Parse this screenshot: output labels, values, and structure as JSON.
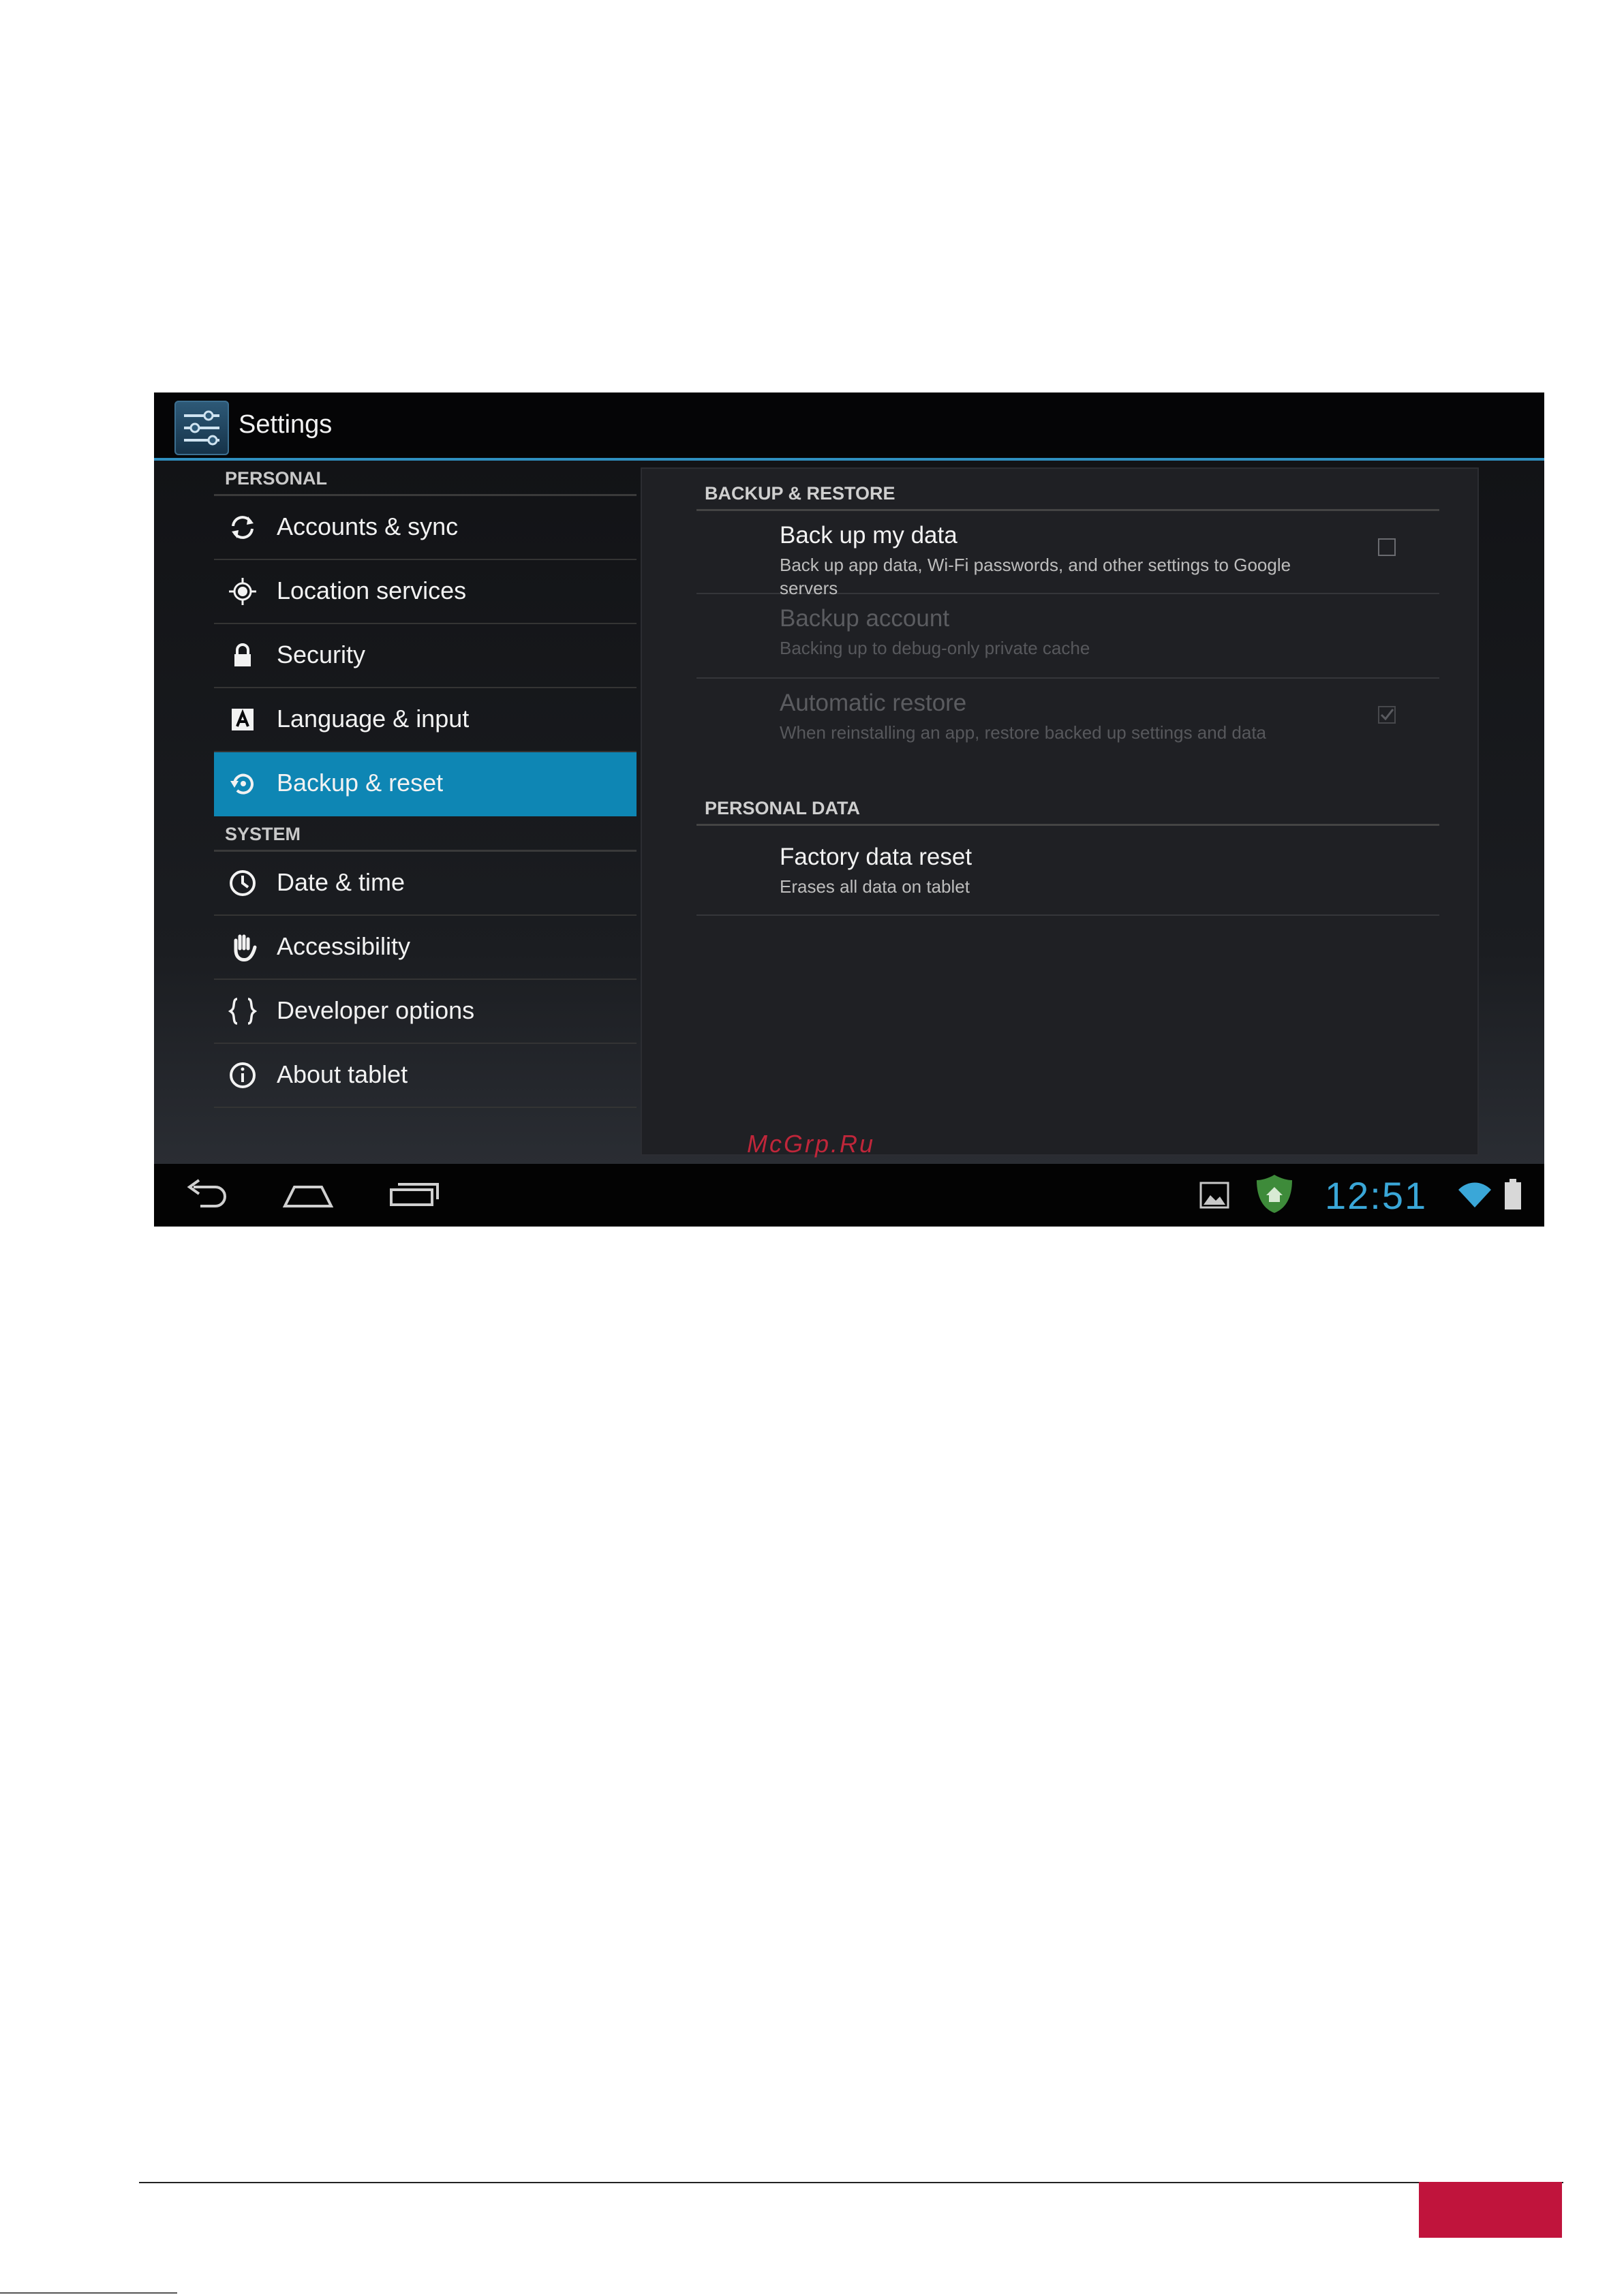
{
  "actionbar": {
    "title": "Settings"
  },
  "sidebar": {
    "sections": [
      {
        "header": "PERSONAL",
        "items": [
          {
            "label": "Accounts & sync",
            "icon": "sync-icon"
          },
          {
            "label": "Location services",
            "icon": "location-icon"
          },
          {
            "label": "Security",
            "icon": "lock-icon"
          },
          {
            "label": "Language & input",
            "icon": "language-icon"
          },
          {
            "label": "Backup & reset",
            "icon": "backup-icon",
            "selected": true
          }
        ]
      },
      {
        "header": "SYSTEM",
        "items": [
          {
            "label": "Date & time",
            "icon": "clock-icon"
          },
          {
            "label": "Accessibility",
            "icon": "hand-icon"
          },
          {
            "label": "Developer options",
            "icon": "braces-icon"
          },
          {
            "label": "About tablet",
            "icon": "info-icon"
          }
        ]
      }
    ]
  },
  "main": {
    "backup_header": "BACKUP & RESTORE",
    "backup_data": {
      "title": "Back up my data",
      "summary": "Back up app data, Wi-Fi passwords, and other settings to Google servers",
      "checked": false
    },
    "backup_account": {
      "title": "Backup account",
      "summary": "Backing up to debug-only private cache",
      "enabled": false
    },
    "auto_restore": {
      "title": "Automatic restore",
      "summary": "When reinstalling an app, restore backed up settings and data",
      "checked": true,
      "enabled": false
    },
    "personal_header": "PERSONAL DATA",
    "factory_reset": {
      "title": "Factory data reset",
      "summary": "Erases all data on tablet"
    }
  },
  "status_bar": {
    "time": "12:51"
  },
  "watermark": "McGrp.Ru",
  "colors": {
    "accent": "#0e86b4",
    "clock": "#3aa7d8",
    "footer_box": "#c0143c"
  }
}
